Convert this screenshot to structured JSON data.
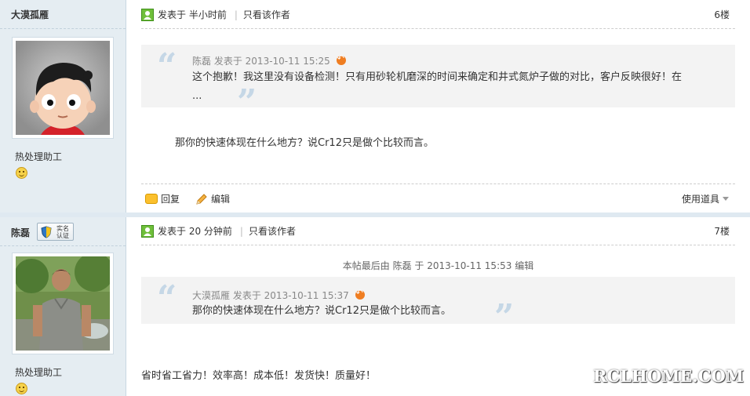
{
  "posts": [
    {
      "author": "大漠孤雁",
      "rank": "热处理助工",
      "posted": "发表于 半小时前",
      "only_author": "只看该作者",
      "floor": "6楼",
      "quote": {
        "author": "陈磊",
        "time": "发表于 2013-10-11 15:25",
        "body_line1": "这个抱歉！我这里没有设备检测！只有用砂轮机磨深的时间来确定和井式氮炉子做的对比，客户反映很好！在",
        "body_line2": "..."
      },
      "text": "那你的快速体现在什么地方？说Cr12只是做个比较而言。",
      "actions": {
        "reply": "回复",
        "edit": "编辑",
        "tools": "使用道具"
      }
    },
    {
      "author": "陈磊",
      "badge": "实名认证",
      "rank": "热处理助工",
      "posted": "发表于 20 分钟前",
      "only_author": "只看该作者",
      "floor": "7楼",
      "edit_note": "本帖最后由 陈磊 于 2013-10-11 15:53 编辑",
      "quote": {
        "author": "大漠孤雁",
        "time": "发表于 2013-10-11 15:37",
        "body_line1": "那你的快速体现在什么地方？说Cr12只是做个比较而言。"
      },
      "text": "省时省工省力！效率高！成本低！发货快！质量好！"
    }
  ],
  "watermark": "RCLHOME.COM",
  "colors": {
    "sidebar_bg": "#e5edf2",
    "quote_bg": "#f3f3f3",
    "accent_orange": "#ef7d21"
  }
}
